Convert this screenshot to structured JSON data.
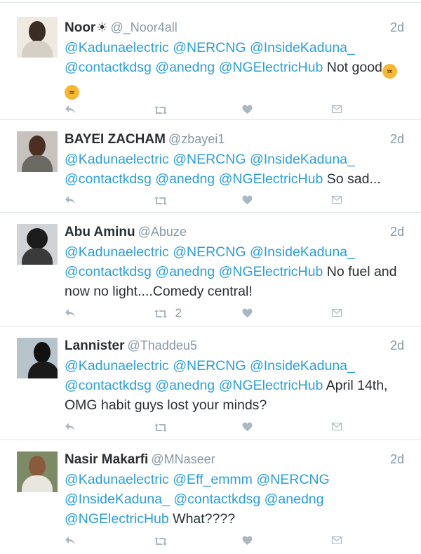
{
  "tweets": [
    {
      "name": "Noor",
      "handle": "@_Noor4all",
      "time": "2d",
      "mentions": [
        "@Kadunaelectric",
        "@NERCNG",
        "@InsideKaduna_",
        "@contactkdsg",
        "@anedng",
        "@NGElectricHub"
      ],
      "text": "Not good",
      "retweets": ""
    },
    {
      "name": "BAYEI ZACHAM",
      "handle": "@zbayei1",
      "time": "2d",
      "mentions": [
        "@Kadunaelectric",
        "@NERCNG",
        "@InsideKaduna_",
        "@contactkdsg",
        "@anedng",
        "@NGElectricHub"
      ],
      "text": "So sad...",
      "retweets": ""
    },
    {
      "name": "Abu Aminu",
      "handle": "@Abuze",
      "time": "2d",
      "mentions": [
        "@Kadunaelectric",
        "@NERCNG",
        "@InsideKaduna_",
        "@contactkdsg",
        "@anedng",
        "@NGElectricHub"
      ],
      "text": "No fuel and now no light....Comedy central!",
      "retweets": "2"
    },
    {
      "name": "Lannister",
      "handle": "@Thaddeu5",
      "time": "2d",
      "mentions": [
        "@Kadunaelectric",
        "@NERCNG",
        "@InsideKaduna_",
        "@contactkdsg",
        "@anedng",
        "@NGElectricHub"
      ],
      "text": "April 14th, OMG habit guys lost your minds?",
      "retweets": ""
    },
    {
      "name": "Nasir Makarfi",
      "handle": "@MNaseer",
      "time": "2d",
      "mentions": [
        "@Kadunaelectric",
        "@Eff_emmm",
        "@NERCNG",
        "@InsideKaduna_",
        "@contactkdsg",
        "@anedng",
        "@NGElectricHub"
      ],
      "text": "What????",
      "retweets": ""
    }
  ],
  "icons": {
    "reply": "reply-icon",
    "retweet": "retweet-icon",
    "like": "heart-icon",
    "dm": "direct-message-icon",
    "sun": "sun-icon",
    "emoji": "angry-face-emoji"
  },
  "colors": {
    "mention": "#2b9fd9",
    "muted": "#8899a6",
    "icon": "#aab8c2",
    "divider": "#e1e8ed"
  }
}
